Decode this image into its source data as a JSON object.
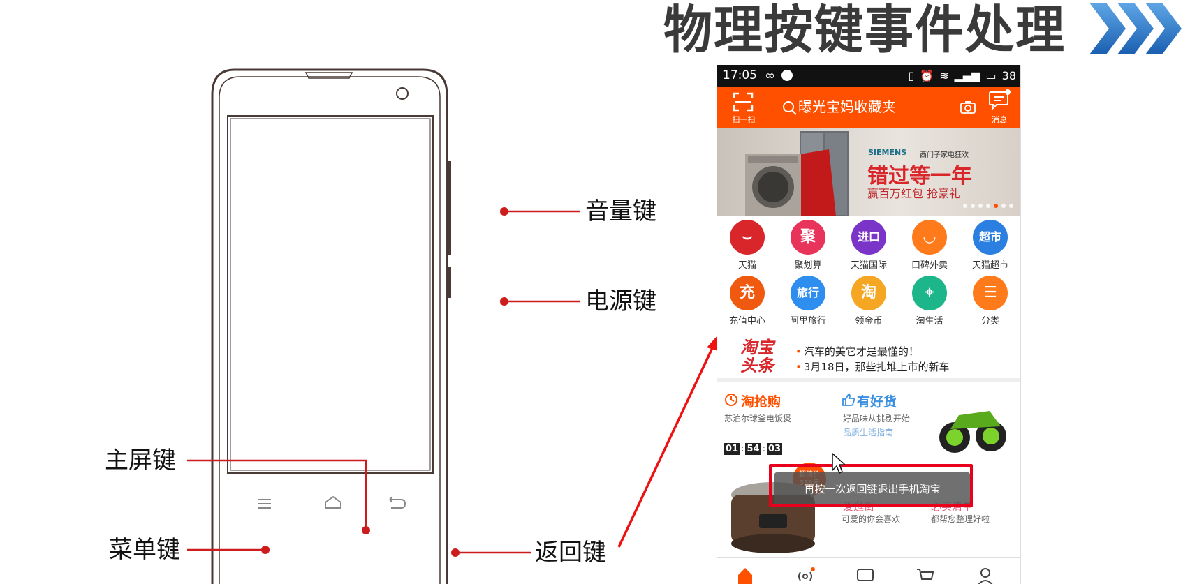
{
  "slide": {
    "title": "物理按键事件处理"
  },
  "callouts": {
    "volume": "音量键",
    "power": "电源键",
    "home": "主屏键",
    "menu": "菜单键",
    "back": "返回键"
  },
  "phone": {
    "status_bar": {
      "time": "17:05",
      "icons": [
        "infinity-icon",
        "notification-icon",
        "vibrate-icon",
        "alarm-icon",
        "wifi-icon",
        "signal-icon",
        "battery-icon"
      ],
      "battery": "38"
    },
    "header": {
      "scan_label": "扫一扫",
      "search_placeholder": "曝光宝妈收藏夹",
      "message_label": "消息",
      "accent_color": "#ff5000"
    },
    "banner": {
      "brand": "SIEMENS",
      "brand_sub": "西门子家电狂欢",
      "headline": "错过等一年",
      "sub": "赢百万红包 抢豪礼"
    },
    "grid": [
      {
        "label": "天猫",
        "glyph": "",
        "color": "#d8262b"
      },
      {
        "label": "聚划算",
        "glyph": "聚",
        "color": "#e8345a"
      },
      {
        "label": "天猫国际",
        "glyph": "进口",
        "color": "#7a34c8"
      },
      {
        "label": "口碑外卖",
        "glyph": "",
        "color": "#ff7a1a"
      },
      {
        "label": "天猫超市",
        "glyph": "超市",
        "color": "#2a7fe0"
      },
      {
        "label": "充值中心",
        "glyph": "充",
        "color": "#f05a10"
      },
      {
        "label": "阿里旅行",
        "glyph": "旅行",
        "color": "#2e8ef0"
      },
      {
        "label": "领金币",
        "glyph": "淘",
        "color": "#f5a623"
      },
      {
        "label": "淘生活",
        "glyph": "",
        "color": "#1cb68a"
      },
      {
        "label": "分类",
        "glyph": "",
        "color": "#ff7a1a"
      }
    ],
    "headlines": {
      "logo": "淘宝头条",
      "items": [
        "汽车的美它才是最懂的！",
        "3月18日，那些扎堆上市的新车"
      ]
    },
    "promo": {
      "flash_title": "淘抢购",
      "flash_sub": "苏泊尔球釜电饭煲",
      "countdown": [
        "01",
        "54",
        "03"
      ],
      "goods_title": "有好货",
      "goods_sub": "好品味从挑剔开始",
      "goods_sub2": "品质生活指南",
      "badge": "超值价 338元",
      "street_title": "爱逛街",
      "street_sub": "可爱的你会喜欢",
      "list_title": "必买清单",
      "list_sub": "都帮您整理好啦"
    },
    "toast": "再按一次返回键退出手机淘宝",
    "tabs": [
      "home-icon",
      "broadcast-icon",
      "chat-icon",
      "cart-icon",
      "profile-icon"
    ]
  }
}
